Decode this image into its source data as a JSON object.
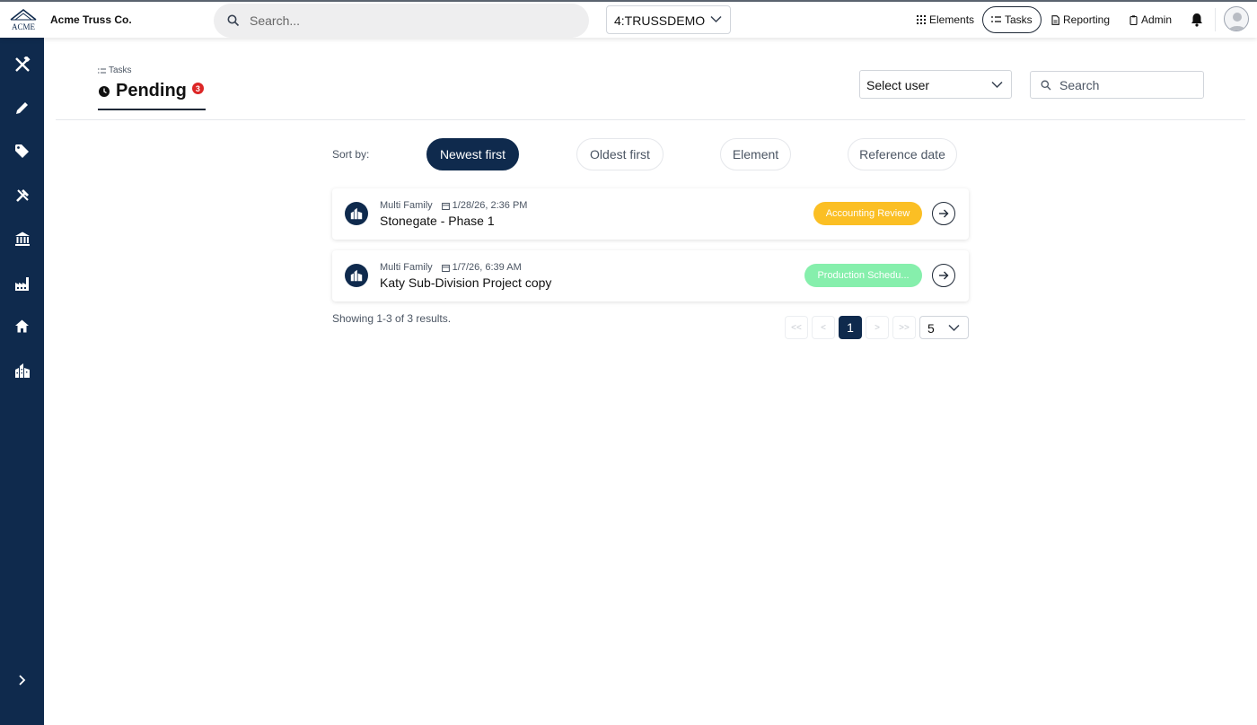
{
  "app": {
    "company_name": "Acme Truss Co.",
    "logo_text": "ACME",
    "search_placeholder": "Search...",
    "org_selected": "4:TRUSSDEMO"
  },
  "nav": {
    "elements": "Elements",
    "tasks": "Tasks",
    "reporting": "Reporting",
    "admin": "Admin"
  },
  "sidebar": {
    "items": [
      {
        "icon": "design-tools-icon"
      },
      {
        "icon": "pencil-icon"
      },
      {
        "icon": "tag-icon"
      },
      {
        "icon": "tools-icon"
      },
      {
        "icon": "bank-icon"
      },
      {
        "icon": "factory-icon"
      },
      {
        "icon": "home-icon"
      },
      {
        "icon": "buildings-icon"
      }
    ],
    "expand_icon": "chevron-right-icon"
  },
  "page": {
    "breadcrumb": "Tasks",
    "title": "Pending",
    "pending_count": "3",
    "user_select_value": "Select user",
    "search_placeholder": "Search"
  },
  "sort": {
    "label": "Sort by:",
    "options": [
      "Newest first",
      "Oldest first",
      "Element",
      "Reference date"
    ],
    "active": "Newest first"
  },
  "tasks": [
    {
      "category": "Multi Family",
      "date": "1/28/26, 2:36 PM",
      "title": "Stonegate - Phase 1",
      "status": "Accounting Review",
      "status_color": "#fbbf24"
    },
    {
      "category": "Multi Family",
      "date": "1/7/26, 6:39 AM",
      "title": "Katy Sub-Division Project copy",
      "status": "Production Schedu...",
      "status_color": "#86efac"
    }
  ],
  "pagination": {
    "summary": "Showing 1-3 of 3 results.",
    "first": "<<",
    "prev": "<",
    "current_page": "1",
    "next": ">",
    "last": ">>",
    "page_size": "5"
  },
  "colors": {
    "sidebar_bg": "#0f2a4d",
    "accent_dark": "#0f2a4d",
    "badge_red": "#dc2626"
  }
}
